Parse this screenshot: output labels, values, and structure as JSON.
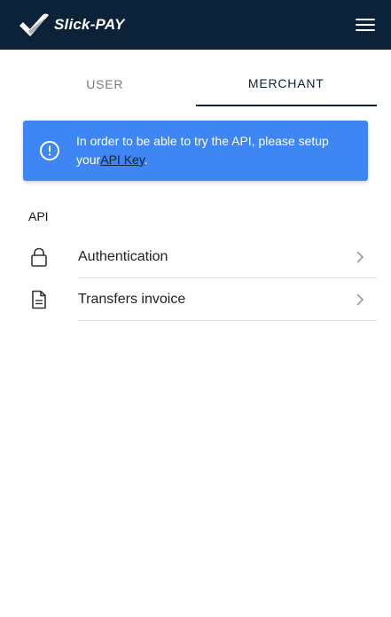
{
  "app": {
    "brand_name": "Slick-PAY",
    "header_color": "#0c2238"
  },
  "tabs": [
    {
      "label": "USER",
      "active": false
    },
    {
      "label": "MERCHANT",
      "active": true
    }
  ],
  "alert": {
    "message": "In order to be able to try the API, please setup your",
    "link_text": "API Key",
    "suffix": ".",
    "color": "#3f86f5",
    "icon": "exclamation-circle-icon"
  },
  "section": {
    "title": "API"
  },
  "list": [
    {
      "label": "Authentication",
      "icon": "lock-icon"
    },
    {
      "label": "Transfers invoice",
      "icon": "document-icon"
    }
  ]
}
